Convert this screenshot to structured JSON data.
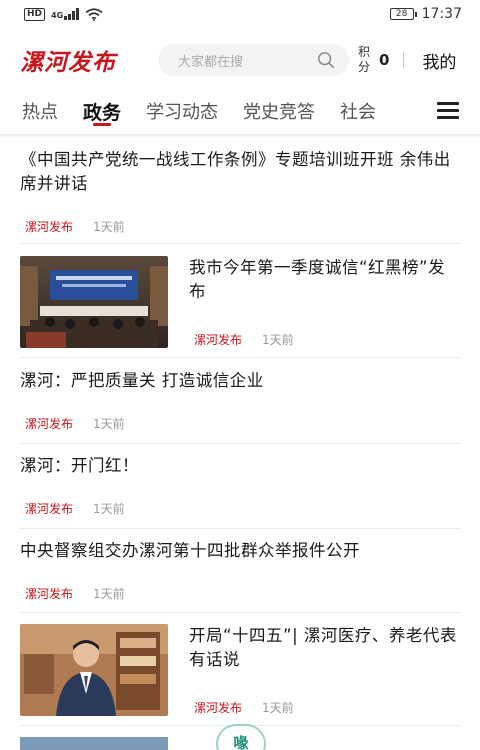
{
  "status": {
    "network_badge": "HD",
    "signal_text": "4G",
    "battery": "28",
    "time": "17:37"
  },
  "header": {
    "logo": "漯河发布",
    "search_placeholder": "大家都在搜",
    "points_label": "积分",
    "points_value": "0",
    "mine_label": "我的"
  },
  "tabs": [
    "热点",
    "政务",
    "学习动态",
    "党史竞答",
    "社会"
  ],
  "active_tab": 1,
  "news": [
    {
      "title": "《中国共产党统一战线工作条例》专题培训班开班 余伟出席并讲话",
      "source": "漯河发布",
      "time": "1天前",
      "has_image": false
    },
    {
      "title": "我市今年第一季度诚信“红黑榜”发布",
      "source": "漯河发布",
      "time": "1天前",
      "has_image": true,
      "image_alt": "meeting-photo"
    },
    {
      "title": "漯河：严把质量关 打造诚信企业",
      "source": "漯河发布",
      "time": "1天前",
      "has_image": false
    },
    {
      "title": "漯河：开门红！",
      "source": "漯河发布",
      "time": "1天前",
      "has_image": false
    },
    {
      "title": "中央督察组交办漯河第十四批群众举报件公开",
      "source": "漯河发布",
      "time": "1天前",
      "has_image": false
    },
    {
      "title": "开局“十四五”| 漯河医疗、养老代表有话说",
      "source": "漯河发布",
      "time": "1天前",
      "has_image": true,
      "image_alt": "person-photo"
    }
  ],
  "bottom_badge": "喙",
  "colors": {
    "brand": "#c8161d",
    "meta_gray": "#999999"
  }
}
